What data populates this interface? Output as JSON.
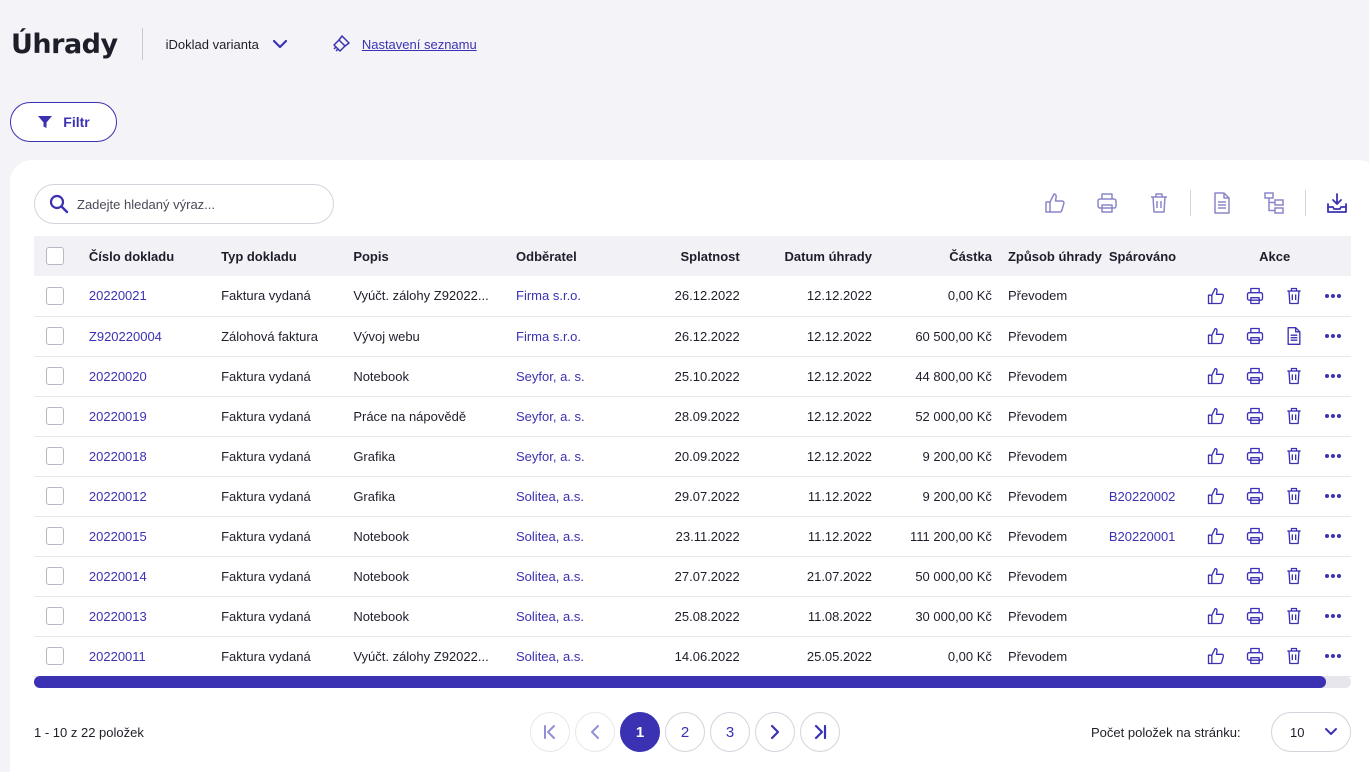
{
  "header": {
    "title": "Úhrady",
    "variant_label": "iDoklad varianta",
    "settings_label": "Nastavení seznamu"
  },
  "filter": {
    "label": "Filtr"
  },
  "search": {
    "placeholder": "Zadejte hledaný výraz..."
  },
  "toolbar": {
    "icons": [
      "thumbs-up-icon",
      "print-icon",
      "trash-icon",
      "document-icon",
      "tree-icon",
      "download-icon"
    ]
  },
  "table": {
    "columns": {
      "number": "Číslo dokladu",
      "type": "Typ dokladu",
      "desc": "Popis",
      "customer": "Odběratel",
      "due": "Splatnost",
      "paid": "Datum úhrady",
      "amount": "Částka",
      "method": "Způsob úhrady",
      "paired": "Spárováno",
      "actions": "Akce"
    },
    "rows": [
      {
        "number": "20220021",
        "type": "Faktura vydaná",
        "desc": "Vyúčt. zálohy Z92022...",
        "customer": "Firma s.r.o.",
        "due": "26.12.2022",
        "paid": "12.12.2022",
        "amount": "0,00 Kč",
        "method": "Převodem",
        "paired": "",
        "third_icon": "trash"
      },
      {
        "number": "Z920220004",
        "type": "Zálohová faktura",
        "desc": "Vývoj webu",
        "customer": "Firma s.r.o.",
        "due": "26.12.2022",
        "paid": "12.12.2022",
        "amount": "60 500,00 Kč",
        "method": "Převodem",
        "paired": "",
        "third_icon": "document"
      },
      {
        "number": "20220020",
        "type": "Faktura vydaná",
        "desc": "Notebook",
        "customer": "Seyfor, a. s.",
        "due": "25.10.2022",
        "paid": "12.12.2022",
        "amount": "44 800,00 Kč",
        "method": "Převodem",
        "paired": "",
        "third_icon": "trash"
      },
      {
        "number": "20220019",
        "type": "Faktura vydaná",
        "desc": "Práce na nápovědě",
        "customer": "Seyfor, a. s.",
        "due": "28.09.2022",
        "paid": "12.12.2022",
        "amount": "52 000,00 Kč",
        "method": "Převodem",
        "paired": "",
        "third_icon": "trash"
      },
      {
        "number": "20220018",
        "type": "Faktura vydaná",
        "desc": "Grafika",
        "customer": "Seyfor, a. s.",
        "due": "20.09.2022",
        "paid": "12.12.2022",
        "amount": "9 200,00 Kč",
        "method": "Převodem",
        "paired": "",
        "third_icon": "trash"
      },
      {
        "number": "20220012",
        "type": "Faktura vydaná",
        "desc": "Grafika",
        "customer": "Solitea, a.s.",
        "due": "29.07.2022",
        "paid": "11.12.2022",
        "amount": "9 200,00 Kč",
        "method": "Převodem",
        "paired": "B20220002",
        "third_icon": "trash"
      },
      {
        "number": "20220015",
        "type": "Faktura vydaná",
        "desc": "Notebook",
        "customer": "Solitea, a.s.",
        "due": "23.11.2022",
        "paid": "11.12.2022",
        "amount": "111 200,00 Kč",
        "method": "Převodem",
        "paired": "B20220001",
        "third_icon": "trash"
      },
      {
        "number": "20220014",
        "type": "Faktura vydaná",
        "desc": "Notebook",
        "customer": "Solitea, a.s.",
        "due": "27.07.2022",
        "paid": "21.07.2022",
        "amount": "50 000,00 Kč",
        "method": "Převodem",
        "paired": "",
        "third_icon": "trash"
      },
      {
        "number": "20220013",
        "type": "Faktura vydaná",
        "desc": "Notebook",
        "customer": "Solitea, a.s.",
        "due": "25.08.2022",
        "paid": "11.08.2022",
        "amount": "30 000,00 Kč",
        "method": "Převodem",
        "paired": "",
        "third_icon": "trash"
      },
      {
        "number": "20220011",
        "type": "Faktura vydaná",
        "desc": "Vyúčt. zálohy Z92022...",
        "customer": "Solitea, a.s.",
        "due": "14.06.2022",
        "paid": "25.05.2022",
        "amount": "0,00 Kč",
        "method": "Převodem",
        "paired": "",
        "third_icon": "trash"
      }
    ]
  },
  "footer": {
    "count_text": "1 - 10 z 22 položek",
    "pages": [
      "1",
      "2",
      "3"
    ],
    "current_page": "1",
    "per_page_label": "Počet položek na stránku:",
    "per_page_value": "10"
  },
  "colors": {
    "accent": "#3b32b3",
    "background": "#f4f4f8"
  }
}
